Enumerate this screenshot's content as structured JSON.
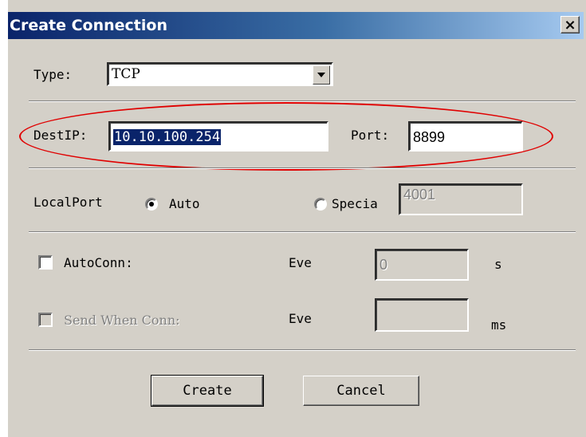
{
  "window": {
    "title": "Create Connection",
    "close_label": "×"
  },
  "type": {
    "label": "Type:",
    "value": "TCP"
  },
  "dest": {
    "label": "DestIP:",
    "ip": "10.10.100.254",
    "port_label": "Port:",
    "port": "8899"
  },
  "local": {
    "label": "LocalPort",
    "auto_label": "Auto",
    "auto_selected": true,
    "specia_label": "Specia",
    "specia_value": "4001"
  },
  "autoconn": {
    "label": "AutoConn:",
    "eve_label": "Eve",
    "value": "0",
    "unit": "s",
    "checked": false
  },
  "sendwhen": {
    "label": "Send When Conn:",
    "eve_label": "Eve",
    "value": "",
    "unit": "ms",
    "checked": false,
    "disabled": true
  },
  "buttons": {
    "create": "Create",
    "cancel": "Cancel"
  },
  "colors": {
    "titlebar_start": "#0a246a",
    "titlebar_end": "#a6caf0",
    "dialog_bg": "#d4d0c8",
    "selection": "#0a246a",
    "annotation": "#e00000"
  }
}
